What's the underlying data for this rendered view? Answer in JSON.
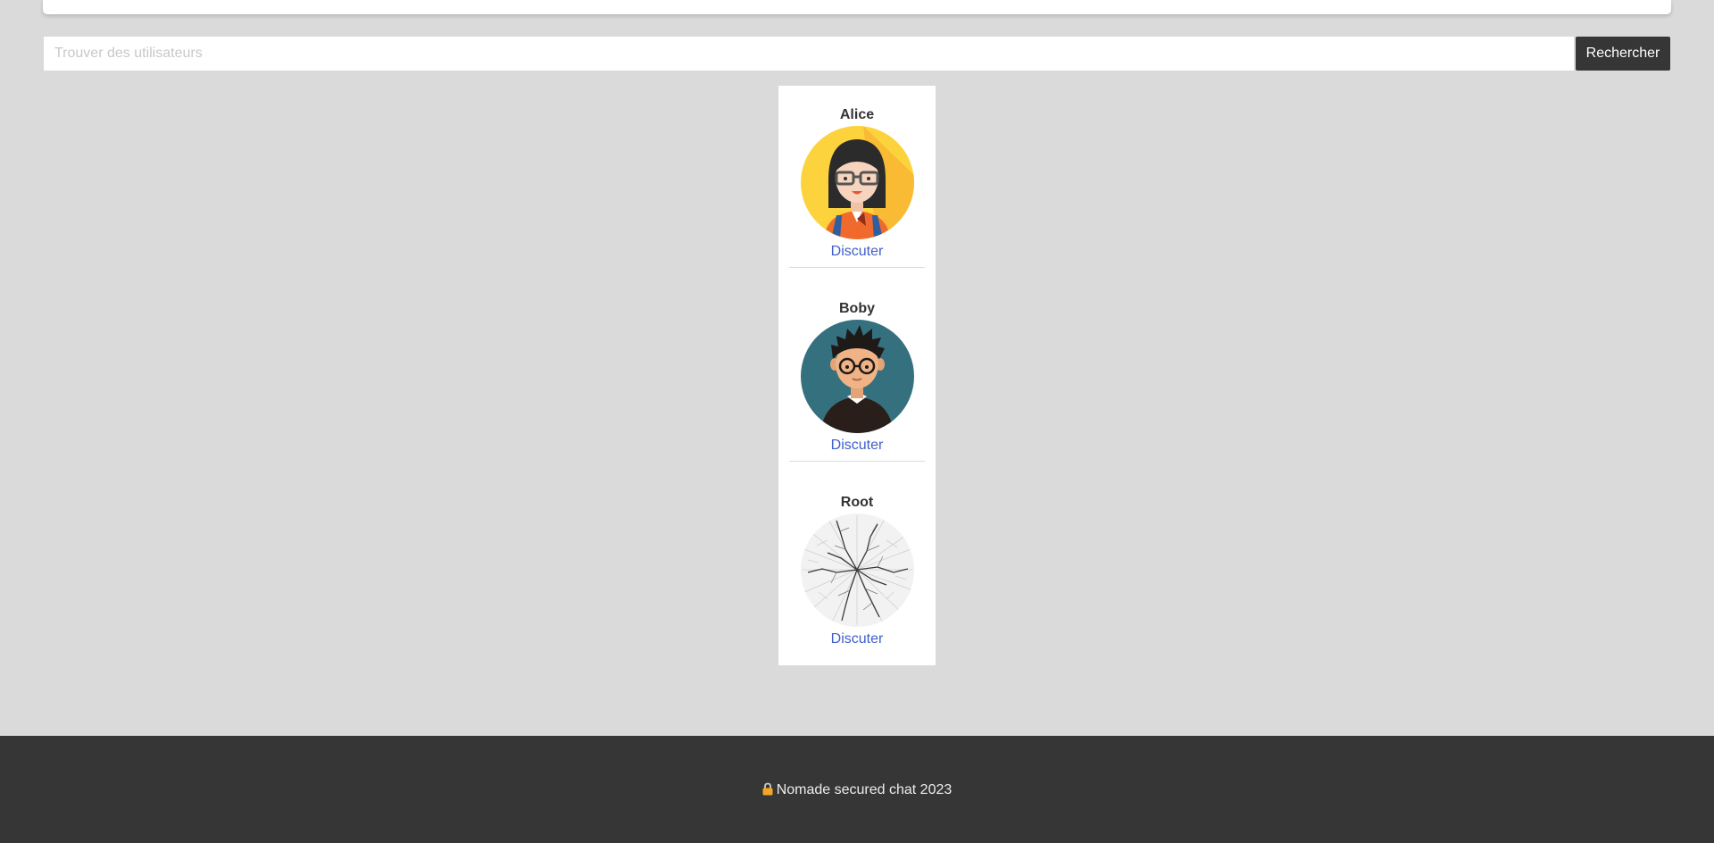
{
  "search": {
    "placeholder": "Trouver des utilisateurs",
    "button_label": "Rechercher"
  },
  "users": [
    {
      "name": "Alice",
      "action_label": "Discuter",
      "avatar_icon": "woman-glasses-avatar-icon",
      "avatar_color": "#fdd33d"
    },
    {
      "name": "Boby",
      "action_label": "Discuter",
      "avatar_icon": "man-glasses-avatar-icon",
      "avatar_color": "#35707f"
    },
    {
      "name": "Root",
      "action_label": "Discuter",
      "avatar_icon": "root-tree-avatar-icon",
      "avatar_color": "#f0f0f0"
    }
  ],
  "footer": {
    "text": "Nomade secured chat 2023",
    "icon": "lock-icon"
  },
  "colors": {
    "background": "#dadada",
    "footer_bg": "#363636",
    "button_bg": "#363636",
    "link": "#3f5ecb"
  }
}
